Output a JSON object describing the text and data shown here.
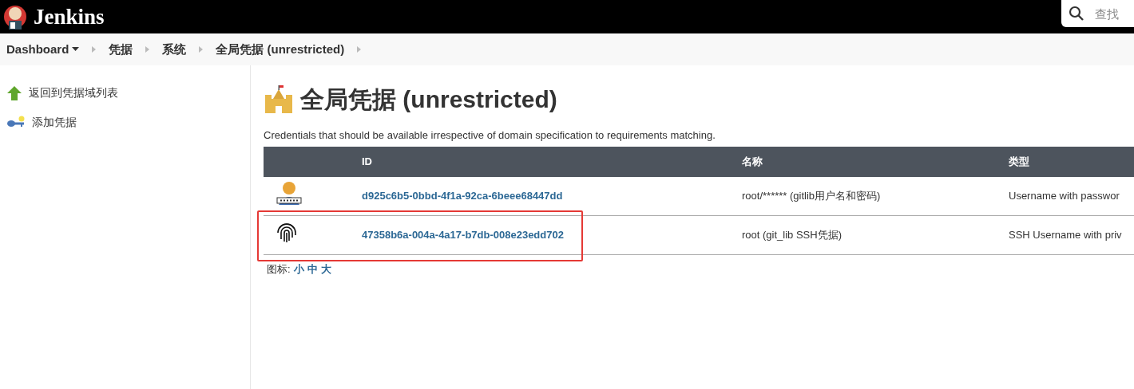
{
  "header": {
    "title": "Jenkins",
    "search": {
      "placeholder": "查找"
    }
  },
  "breadcrumbs": [
    {
      "label": "Dashboard",
      "menu": true
    },
    {
      "label": "凭据",
      "menu": false
    },
    {
      "label": "系统",
      "menu": false
    },
    {
      "label": "全局凭据 (unrestricted)",
      "menu": false
    }
  ],
  "sidebar": {
    "items": [
      {
        "label": "返回到凭据域列表",
        "kind": "up"
      },
      {
        "label": "添加凭据",
        "kind": "key"
      }
    ]
  },
  "heading": "全局凭据 (unrestricted)",
  "description": "Credentials that should be available irrespective of domain specification to requirements matching.",
  "table": {
    "columns": [
      "ID",
      "名称",
      "类型"
    ],
    "rows": [
      {
        "kind": "password",
        "id": "d925c6b5-0bbd-4f1a-92ca-6beee68447dd",
        "name": "root/****** (gitlib用户名和密码)",
        "type": "Username with passwor",
        "highlighted": false
      },
      {
        "kind": "ssh",
        "id": "47358b6a-004a-4a17-b7db-008e23edd702",
        "name": "root (git_lib SSH凭据)",
        "type": "SSH Username with priv",
        "highlighted": true
      }
    ]
  },
  "icon_sizes": {
    "label": "图标:",
    "options": [
      "小",
      "中",
      "大"
    ]
  }
}
